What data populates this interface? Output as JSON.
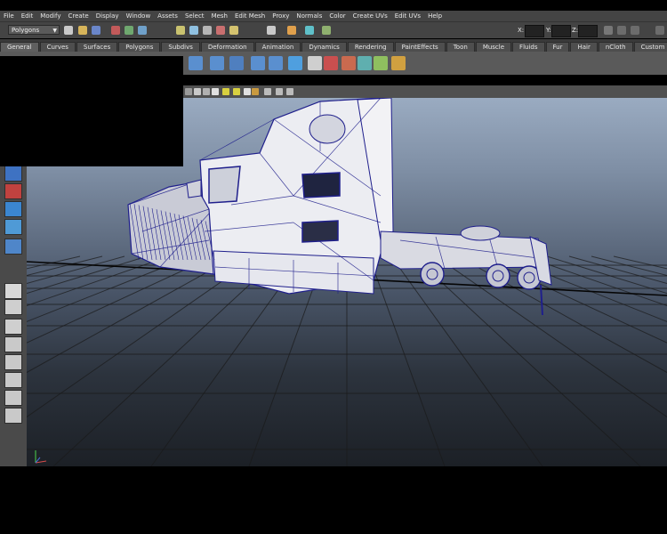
{
  "menu": [
    "File",
    "Edit",
    "Modify",
    "Create",
    "Display",
    "Window",
    "Assets",
    "Select",
    "Mesh",
    "Edit Mesh",
    "Proxy",
    "Normals",
    "Color",
    "Create UVs",
    "Edit UVs",
    "Help"
  ],
  "status_line": {
    "mode": "Polygons",
    "x_label": "X:",
    "y_label": "Y:",
    "z_label": "Z:",
    "x_value": "",
    "y_value": "",
    "z_value": ""
  },
  "shelf_tabs": [
    "General",
    "Curves",
    "Surfaces",
    "Polygons",
    "Subdivs",
    "Deformation",
    "Animation",
    "Dynamics",
    "Rendering",
    "PaintEffects",
    "Toon",
    "Muscle",
    "Fluids",
    "Fur",
    "Hair",
    "nCloth",
    "Custom"
  ],
  "active_shelf_tab": "General",
  "icons": {
    "status_line": [
      "new-scene-icon",
      "open-scene-icon",
      "save-scene-icon",
      "select-hierarchy-icon",
      "select-object-icon",
      "select-component-icon",
      "snap-grid-icon",
      "snap-curve-icon",
      "snap-point-icon",
      "snap-plane-icon",
      "make-live-icon",
      "history-icon",
      "render-icon",
      "ipr-render-icon",
      "render-settings-icon"
    ],
    "shelf": [
      "move-pivot-icon",
      "group-icon",
      "ungroup-icon",
      "parent-icon",
      "unparent-icon",
      "freeze-transforms-icon",
      "delete-history-icon",
      "hypershade-icon",
      "render-view-icon",
      "render-current-icon",
      "ipr-icon",
      "paint-brush-icon"
    ],
    "toolbox": [
      "select-tool-icon",
      "lasso-tool-icon",
      "paint-select-icon",
      "move-tool-icon",
      "rotate-tool-icon",
      "scale-tool-icon",
      "layout-single-icon",
      "layout-four-icon",
      "layout-outliner-icon",
      "layout-graph-icon",
      "layout-hypershade-icon",
      "layout-render-icon",
      "layout-uv-icon"
    ]
  },
  "viewport": {
    "subject": "truck-wireframe",
    "wire_color": "#1f1f8c",
    "mesh_color": "#ecedf2",
    "grid_color": "#1a1a1a"
  },
  "colors": {
    "ui_dark": "#444444",
    "tab_bg": "#4e4e4e",
    "shelf_bg": "#5a5a5a",
    "viewport_top": "#9aabc1",
    "viewport_bottom": "#1c2026"
  }
}
